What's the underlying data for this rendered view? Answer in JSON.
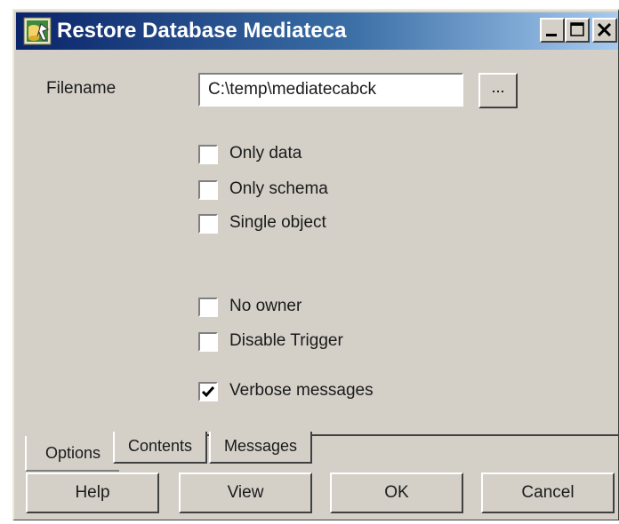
{
  "window": {
    "title": "Restore Database Mediateca",
    "icon": "database-restore-icon",
    "controls": [
      "minimize-icon",
      "maximize-icon",
      "close-icon"
    ]
  },
  "form": {
    "filename_label": "Filename",
    "filename_value": "C:\\temp\\mediatecabck",
    "browse_label": "..."
  },
  "options": {
    "only_data": {
      "label": "Only data",
      "checked": false
    },
    "only_schema": {
      "label": "Only schema",
      "checked": false
    },
    "single_object": {
      "label": "Single object",
      "checked": false
    },
    "no_owner": {
      "label": "No owner",
      "checked": false
    },
    "disable_trigger": {
      "label": "Disable Trigger",
      "checked": false
    },
    "verbose_messages": {
      "label": "Verbose messages",
      "checked": true
    }
  },
  "tabs": [
    {
      "label": "Options",
      "active": true
    },
    {
      "label": "Contents",
      "active": false
    },
    {
      "label": "Messages",
      "active": false
    }
  ],
  "buttons": {
    "help": "Help",
    "view": "View",
    "ok": "OK",
    "cancel": "Cancel"
  },
  "colors": {
    "face": "#d4d0c8",
    "title_start": "#0a246a",
    "title_end": "#a6caf0"
  }
}
